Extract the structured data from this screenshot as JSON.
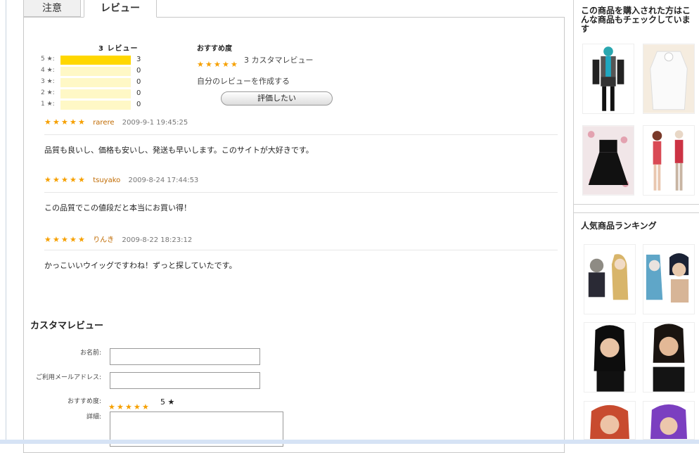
{
  "tabs": [
    {
      "label": "注意"
    },
    {
      "label": "レビュー"
    }
  ],
  "summary": {
    "title": "3 レビュー",
    "rows": [
      {
        "label": "5 ★:",
        "count": "3",
        "fill": 1.0
      },
      {
        "label": "4 ★:",
        "count": "0",
        "fill": 0
      },
      {
        "label": "3 ★:",
        "count": "0",
        "fill": 0
      },
      {
        "label": "2 ★:",
        "count": "0",
        "fill": 0
      },
      {
        "label": "1 ★:",
        "count": "0",
        "fill": 0
      }
    ]
  },
  "recommend": {
    "label": "おすすめ度",
    "stars": 5,
    "count_text": "3 カスタマレビュー",
    "write_link": "自分のレビューを作成する",
    "button": "評価したい"
  },
  "reviews": [
    {
      "stars": 5,
      "author": "rarere",
      "date": "2009-9-1 19:45:25",
      "text": "品質も良いし、価格も安いし、発送も早いします。このサイトが大好きです。"
    },
    {
      "stars": 5,
      "author": "tsuyako",
      "date": "2009-8-24 17:44:53",
      "text": "この品質でこの値段だと本当にお買い得！"
    },
    {
      "stars": 5,
      "author": "りんき",
      "date": "2009-8-22 18:23:12",
      "text": "かっこいいウイッグですわね！ずっと探していたです。"
    }
  ],
  "form": {
    "title": "カスタマレビュー",
    "name_label": "お名前:",
    "email_label": "ご利用メールアドレス:",
    "rating_label": "おすすめ度:",
    "rating_value": "5 ★",
    "detail_label": "詳細:"
  },
  "sidebar": {
    "also_bought_title": "この商品を購入された方はこんな商品もチェックしています",
    "ranking_title": "人気商品ランキング"
  },
  "colors": {
    "star": "#f6a000",
    "bar_fill": "#ffd700",
    "bar_bg": "#fff8c6",
    "author": "#c06a00"
  }
}
